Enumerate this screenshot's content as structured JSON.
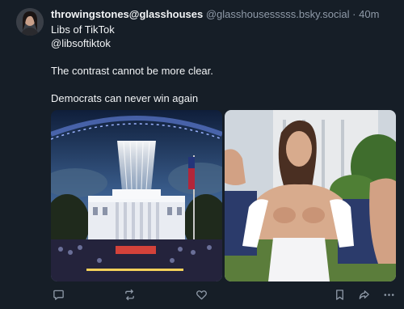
{
  "post": {
    "author_handle": "throwingstones@glasshouses",
    "author_domain": "@glasshousesssss.bsky.social",
    "separator": " · ",
    "time": "40m",
    "lines": [
      "Libs of TikTok",
      "@libsoftiktok"
    ],
    "paragraph1": "The contrast cannot be more clear.",
    "paragraph2": "Democrats can never win again"
  },
  "icons": {
    "reply": "reply-icon",
    "repost": "repost-icon",
    "like": "heart-icon",
    "bookmark": "bookmark-icon",
    "share": "share-icon",
    "more": "more-icon"
  },
  "colors": {
    "background": "#161e27",
    "text": "#f1f3f5",
    "muted": "#8f9aa8",
    "icon": "#8f9aa8"
  }
}
